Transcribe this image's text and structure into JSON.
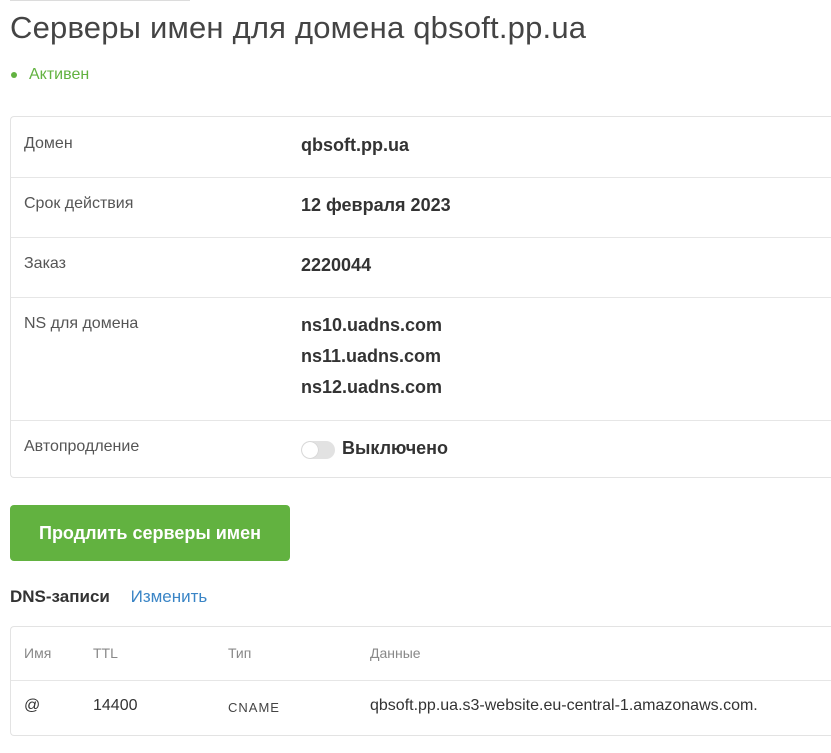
{
  "header": {
    "title": "Серверы имен для домена qbsoft.pp.ua",
    "status": "Активен"
  },
  "info": {
    "domain": {
      "label": "Домен",
      "value": "qbsoft.pp.ua"
    },
    "expiry": {
      "label": "Срок действия",
      "value": "12 февраля 2023"
    },
    "order": {
      "label": "Заказ",
      "value": "2220044"
    },
    "ns": {
      "label": "NS для домена",
      "values": [
        "ns10.uadns.com",
        "ns11.uadns.com",
        "ns12.uadns.com"
      ]
    },
    "autorenew": {
      "label": "Автопродление",
      "state_label": "Выключено",
      "enabled": false
    }
  },
  "actions": {
    "renew_label": "Продлить серверы имен"
  },
  "dns": {
    "title": "DNS-записи",
    "edit_label": "Изменить",
    "columns": [
      "Имя",
      "TTL",
      "Тип",
      "Данные"
    ],
    "records": [
      {
        "name": "@",
        "ttl": "14400",
        "type": "CNAME",
        "data": "qbsoft.pp.ua.s3-website.eu-central-1.amazonaws.com."
      }
    ]
  },
  "colors": {
    "accent": "#62b240",
    "link": "#3a85c6",
    "border": "#e3e3e3"
  }
}
